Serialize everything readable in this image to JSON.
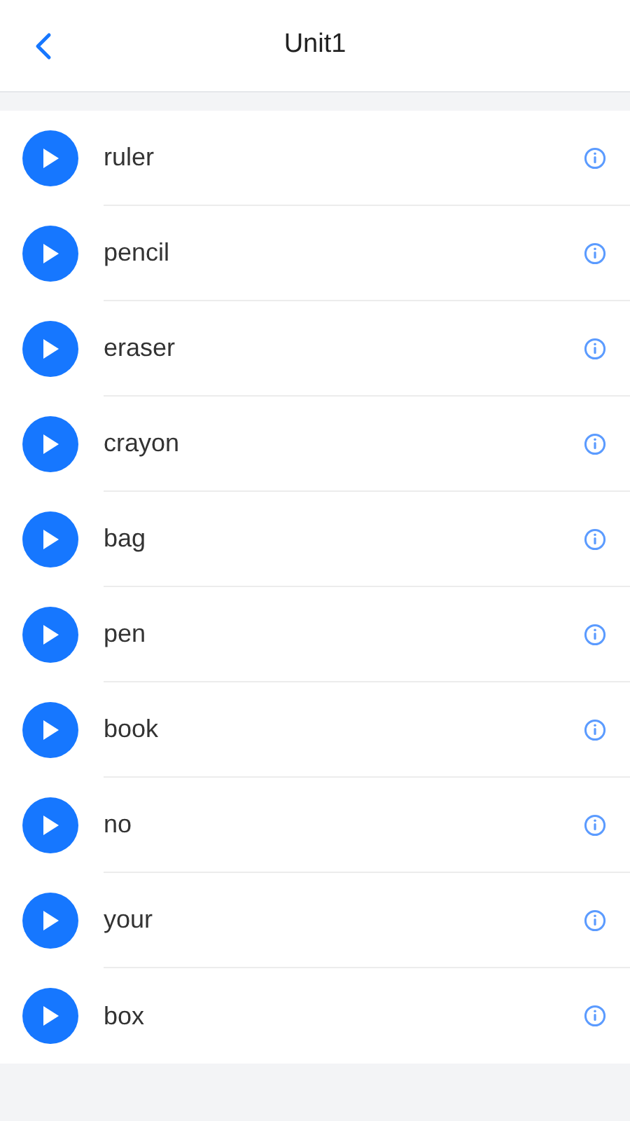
{
  "header": {
    "title": "Unit1"
  },
  "words": [
    {
      "word": "ruler"
    },
    {
      "word": "pencil"
    },
    {
      "word": "eraser"
    },
    {
      "word": "crayon"
    },
    {
      "word": "bag"
    },
    {
      "word": "pen"
    },
    {
      "word": "book"
    },
    {
      "word": "no"
    },
    {
      "word": "your"
    },
    {
      "word": "box"
    }
  ]
}
